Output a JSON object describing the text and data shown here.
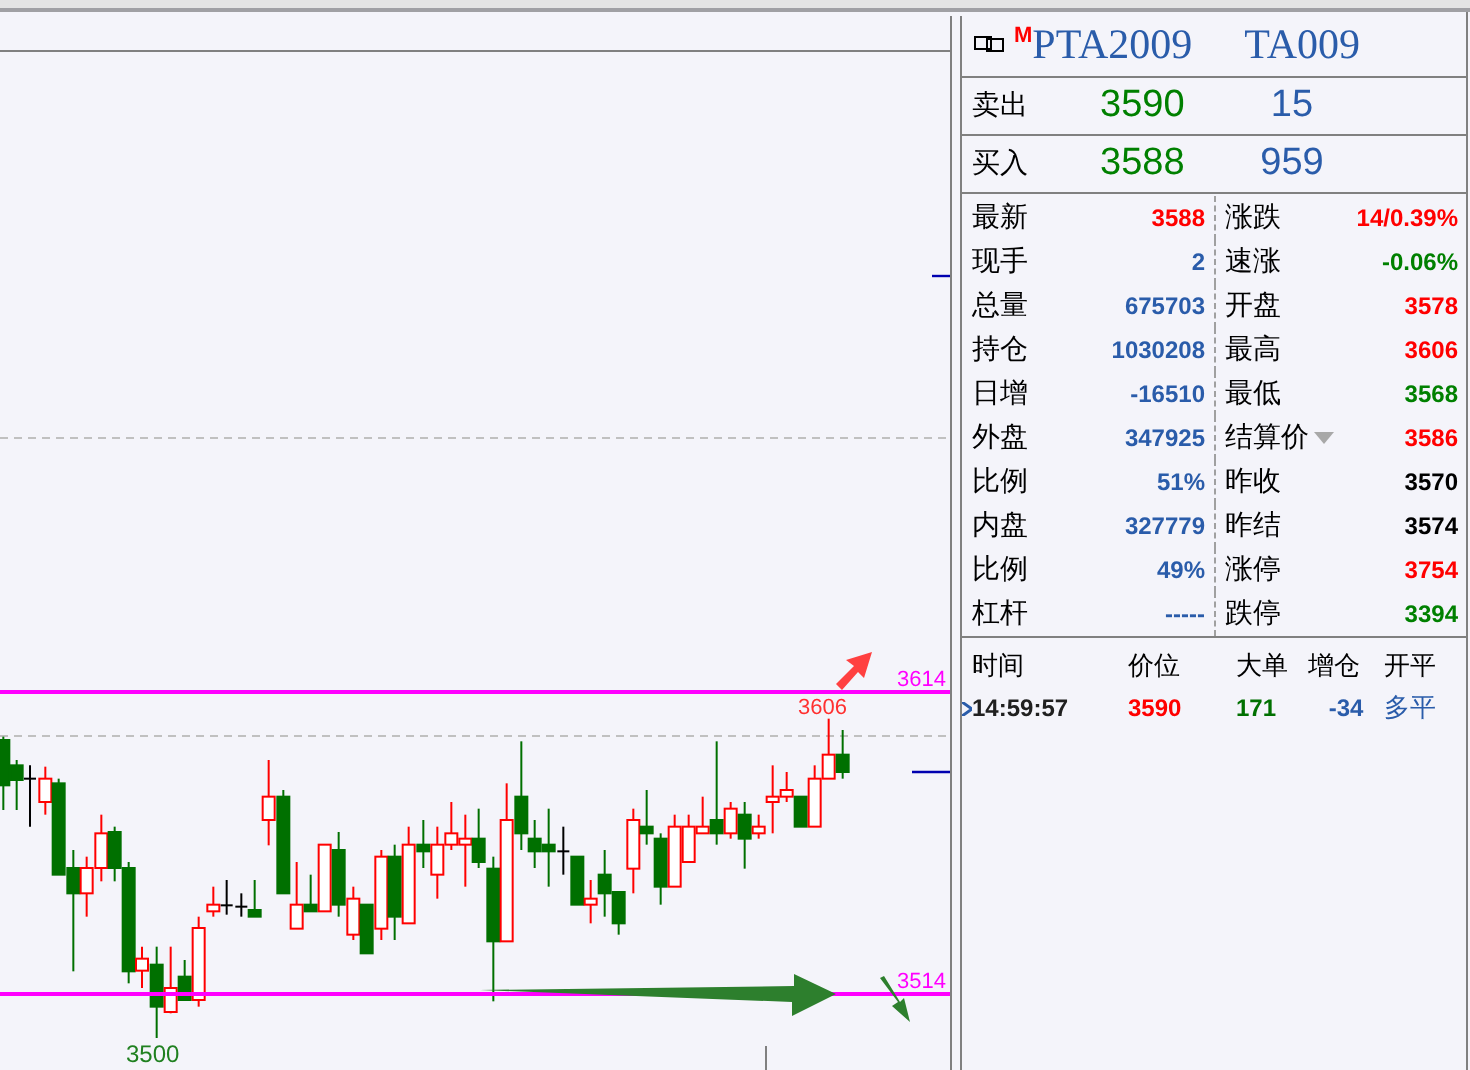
{
  "instrument": {
    "badge": "M",
    "name": "PTA2009",
    "code": "TA009"
  },
  "order_book": [
    {
      "label": "卖出",
      "price": "3590",
      "volume": "15"
    },
    {
      "label": "买入",
      "price": "3588",
      "volume": "959"
    }
  ],
  "stats": [
    {
      "left": {
        "label": "最新",
        "value": "3588",
        "color": "#ff0000"
      },
      "right": {
        "label": "涨跌",
        "value": "14/0.39%",
        "color": "#ff0000",
        "dropdown": false
      }
    },
    {
      "left": {
        "label": "现手",
        "value": "2",
        "color": "#2a5caa"
      },
      "right": {
        "label": "速涨",
        "value": "-0.06%",
        "color": "#008000",
        "dropdown": false
      }
    },
    {
      "left": {
        "label": "总量",
        "value": "675703",
        "color": "#2a5caa"
      },
      "right": {
        "label": "开盘",
        "value": "3578",
        "color": "#ff0000",
        "dropdown": false
      }
    },
    {
      "left": {
        "label": "持仓",
        "value": "1030208",
        "color": "#2a5caa"
      },
      "right": {
        "label": "最高",
        "value": "3606",
        "color": "#ff0000",
        "dropdown": false
      }
    },
    {
      "left": {
        "label": "日增",
        "value": "-16510",
        "color": "#2a5caa"
      },
      "right": {
        "label": "最低",
        "value": "3568",
        "color": "#008000",
        "dropdown": false
      }
    },
    {
      "left": {
        "label": "外盘",
        "value": "347925",
        "color": "#2a5caa"
      },
      "right": {
        "label": "结算价",
        "value": "3586",
        "color": "#ff0000",
        "dropdown": true
      }
    },
    {
      "left": {
        "label": "比例",
        "value": "51%",
        "color": "#2a5caa"
      },
      "right": {
        "label": "昨收",
        "value": "3570",
        "color": "#000000",
        "dropdown": false
      }
    },
    {
      "left": {
        "label": "内盘",
        "value": "327779",
        "color": "#2a5caa"
      },
      "right": {
        "label": "昨结",
        "value": "3574",
        "color": "#000000",
        "dropdown": false
      }
    },
    {
      "left": {
        "label": "比例",
        "value": "49%",
        "color": "#2a5caa"
      },
      "right": {
        "label": "涨停",
        "value": "3754",
        "color": "#ff0000",
        "dropdown": false
      }
    },
    {
      "left": {
        "label": "杠杆",
        "value": "-----",
        "color": "#2a5caa"
      },
      "right": {
        "label": "跌停",
        "value": "3394",
        "color": "#008000",
        "dropdown": false
      }
    }
  ],
  "ticks": {
    "columns": [
      "时间",
      "价位",
      "大单",
      "增仓",
      "开平"
    ],
    "rows": [
      {
        "time": "14:59:57",
        "price": "3590",
        "big_order": "171",
        "oi_change": "-34",
        "open_close": "多平",
        "selected": true
      }
    ]
  },
  "chart": {
    "levels": [
      {
        "label": "3614"
      },
      {
        "label": "3514"
      }
    ],
    "high_label": "3606",
    "low_label": "3500"
  }
}
